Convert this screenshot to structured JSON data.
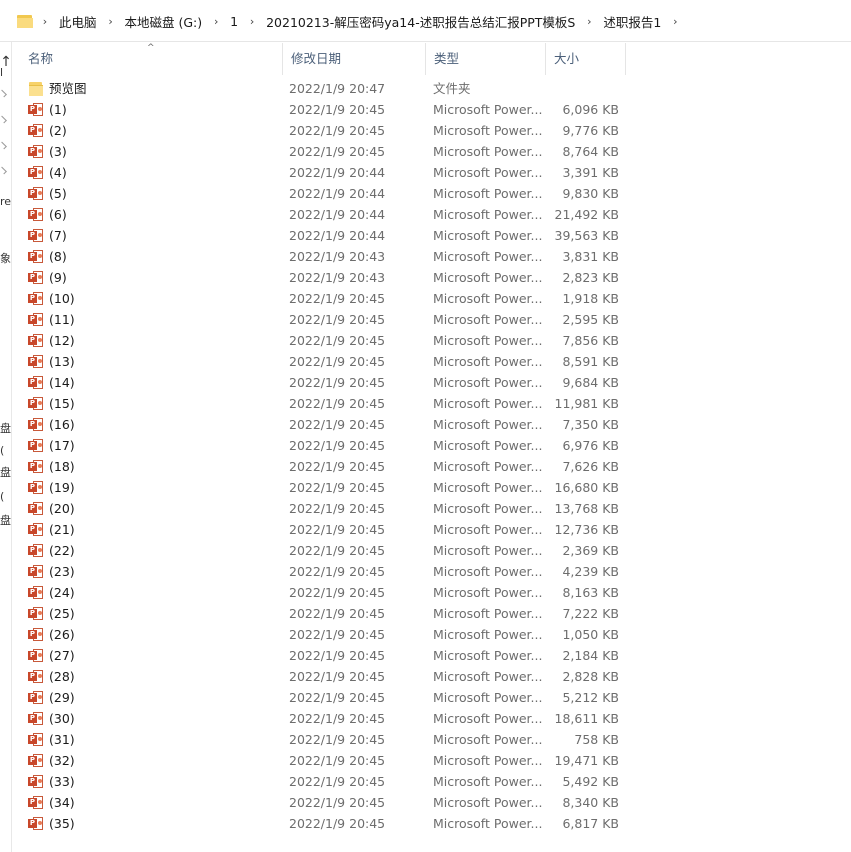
{
  "breadcrumb": [
    "此电脑",
    "本地磁盘 (G:)",
    "1",
    "20210213-解压密码ya14-述职报告总结汇报PPT模板S",
    "述职报告1"
  ],
  "breadcrumb_separator": "›",
  "nav": {
    "up_arrow": "↑",
    "fragments": [
      "l",
      "re",
      "象",
      "盘",
      "(",
      "盘",
      "(",
      "盘"
    ]
  },
  "columns": {
    "name": "名称",
    "date": "修改日期",
    "type": "类型",
    "size": "大小",
    "sort_indicator": "^"
  },
  "files": [
    {
      "name": "预览图",
      "date": "2022/1/9 20:47",
      "type": "文件夹",
      "size": "",
      "kind": "folder"
    },
    {
      "name": "(1)",
      "date": "2022/1/9 20:45",
      "type": "Microsoft Power...",
      "size": "6,096 KB",
      "kind": "ppt"
    },
    {
      "name": "(2)",
      "date": "2022/1/9 20:45",
      "type": "Microsoft Power...",
      "size": "9,776 KB",
      "kind": "ppt"
    },
    {
      "name": "(3)",
      "date": "2022/1/9 20:45",
      "type": "Microsoft Power...",
      "size": "8,764 KB",
      "kind": "ppt"
    },
    {
      "name": "(4)",
      "date": "2022/1/9 20:44",
      "type": "Microsoft Power...",
      "size": "3,391 KB",
      "kind": "ppt"
    },
    {
      "name": "(5)",
      "date": "2022/1/9 20:44",
      "type": "Microsoft Power...",
      "size": "9,830 KB",
      "kind": "ppt"
    },
    {
      "name": "(6)",
      "date": "2022/1/9 20:44",
      "type": "Microsoft Power...",
      "size": "21,492 KB",
      "kind": "ppt"
    },
    {
      "name": "(7)",
      "date": "2022/1/9 20:44",
      "type": "Microsoft Power...",
      "size": "39,563 KB",
      "kind": "ppt"
    },
    {
      "name": "(8)",
      "date": "2022/1/9 20:43",
      "type": "Microsoft Power...",
      "size": "3,831 KB",
      "kind": "ppt"
    },
    {
      "name": "(9)",
      "date": "2022/1/9 20:43",
      "type": "Microsoft Power...",
      "size": "2,823 KB",
      "kind": "ppt"
    },
    {
      "name": "(10)",
      "date": "2022/1/9 20:45",
      "type": "Microsoft Power...",
      "size": "1,918 KB",
      "kind": "ppt"
    },
    {
      "name": "(11)",
      "date": "2022/1/9 20:45",
      "type": "Microsoft Power...",
      "size": "2,595 KB",
      "kind": "ppt"
    },
    {
      "name": "(12)",
      "date": "2022/1/9 20:45",
      "type": "Microsoft Power...",
      "size": "7,856 KB",
      "kind": "ppt"
    },
    {
      "name": "(13)",
      "date": "2022/1/9 20:45",
      "type": "Microsoft Power...",
      "size": "8,591 KB",
      "kind": "ppt"
    },
    {
      "name": "(14)",
      "date": "2022/1/9 20:45",
      "type": "Microsoft Power...",
      "size": "9,684 KB",
      "kind": "ppt"
    },
    {
      "name": "(15)",
      "date": "2022/1/9 20:45",
      "type": "Microsoft Power...",
      "size": "11,981 KB",
      "kind": "ppt"
    },
    {
      "name": "(16)",
      "date": "2022/1/9 20:45",
      "type": "Microsoft Power...",
      "size": "7,350 KB",
      "kind": "ppt"
    },
    {
      "name": "(17)",
      "date": "2022/1/9 20:45",
      "type": "Microsoft Power...",
      "size": "6,976 KB",
      "kind": "ppt"
    },
    {
      "name": "(18)",
      "date": "2022/1/9 20:45",
      "type": "Microsoft Power...",
      "size": "7,626 KB",
      "kind": "ppt"
    },
    {
      "name": "(19)",
      "date": "2022/1/9 20:45",
      "type": "Microsoft Power...",
      "size": "16,680 KB",
      "kind": "ppt"
    },
    {
      "name": "(20)",
      "date": "2022/1/9 20:45",
      "type": "Microsoft Power...",
      "size": "13,768 KB",
      "kind": "ppt"
    },
    {
      "name": "(21)",
      "date": "2022/1/9 20:45",
      "type": "Microsoft Power...",
      "size": "12,736 KB",
      "kind": "ppt"
    },
    {
      "name": "(22)",
      "date": "2022/1/9 20:45",
      "type": "Microsoft Power...",
      "size": "2,369 KB",
      "kind": "ppt"
    },
    {
      "name": "(23)",
      "date": "2022/1/9 20:45",
      "type": "Microsoft Power...",
      "size": "4,239 KB",
      "kind": "ppt"
    },
    {
      "name": "(24)",
      "date": "2022/1/9 20:45",
      "type": "Microsoft Power...",
      "size": "8,163 KB",
      "kind": "ppt"
    },
    {
      "name": "(25)",
      "date": "2022/1/9 20:45",
      "type": "Microsoft Power...",
      "size": "7,222 KB",
      "kind": "ppt"
    },
    {
      "name": "(26)",
      "date": "2022/1/9 20:45",
      "type": "Microsoft Power...",
      "size": "1,050 KB",
      "kind": "ppt"
    },
    {
      "name": "(27)",
      "date": "2022/1/9 20:45",
      "type": "Microsoft Power...",
      "size": "2,184 KB",
      "kind": "ppt"
    },
    {
      "name": "(28)",
      "date": "2022/1/9 20:45",
      "type": "Microsoft Power...",
      "size": "2,828 KB",
      "kind": "ppt"
    },
    {
      "name": "(29)",
      "date": "2022/1/9 20:45",
      "type": "Microsoft Power...",
      "size": "5,212 KB",
      "kind": "ppt"
    },
    {
      "name": "(30)",
      "date": "2022/1/9 20:45",
      "type": "Microsoft Power...",
      "size": "18,611 KB",
      "kind": "ppt"
    },
    {
      "name": "(31)",
      "date": "2022/1/9 20:45",
      "type": "Microsoft Power...",
      "size": "758 KB",
      "kind": "ppt"
    },
    {
      "name": "(32)",
      "date": "2022/1/9 20:45",
      "type": "Microsoft Power...",
      "size": "19,471 KB",
      "kind": "ppt"
    },
    {
      "name": "(33)",
      "date": "2022/1/9 20:45",
      "type": "Microsoft Power...",
      "size": "5,492 KB",
      "kind": "ppt"
    },
    {
      "name": "(34)",
      "date": "2022/1/9 20:45",
      "type": "Microsoft Power...",
      "size": "8,340 KB",
      "kind": "ppt"
    },
    {
      "name": "(35)",
      "date": "2022/1/9 20:45",
      "type": "Microsoft Power...",
      "size": "6,817 KB",
      "kind": "ppt"
    }
  ],
  "icons": {
    "folder": "folder-icon",
    "ppt": "powerpoint-file-icon"
  },
  "colors": {
    "folder": "#f7d26a",
    "ppt": "#c8472a",
    "header_text": "#4c607a",
    "secondary_text": "#6d6d6d"
  }
}
